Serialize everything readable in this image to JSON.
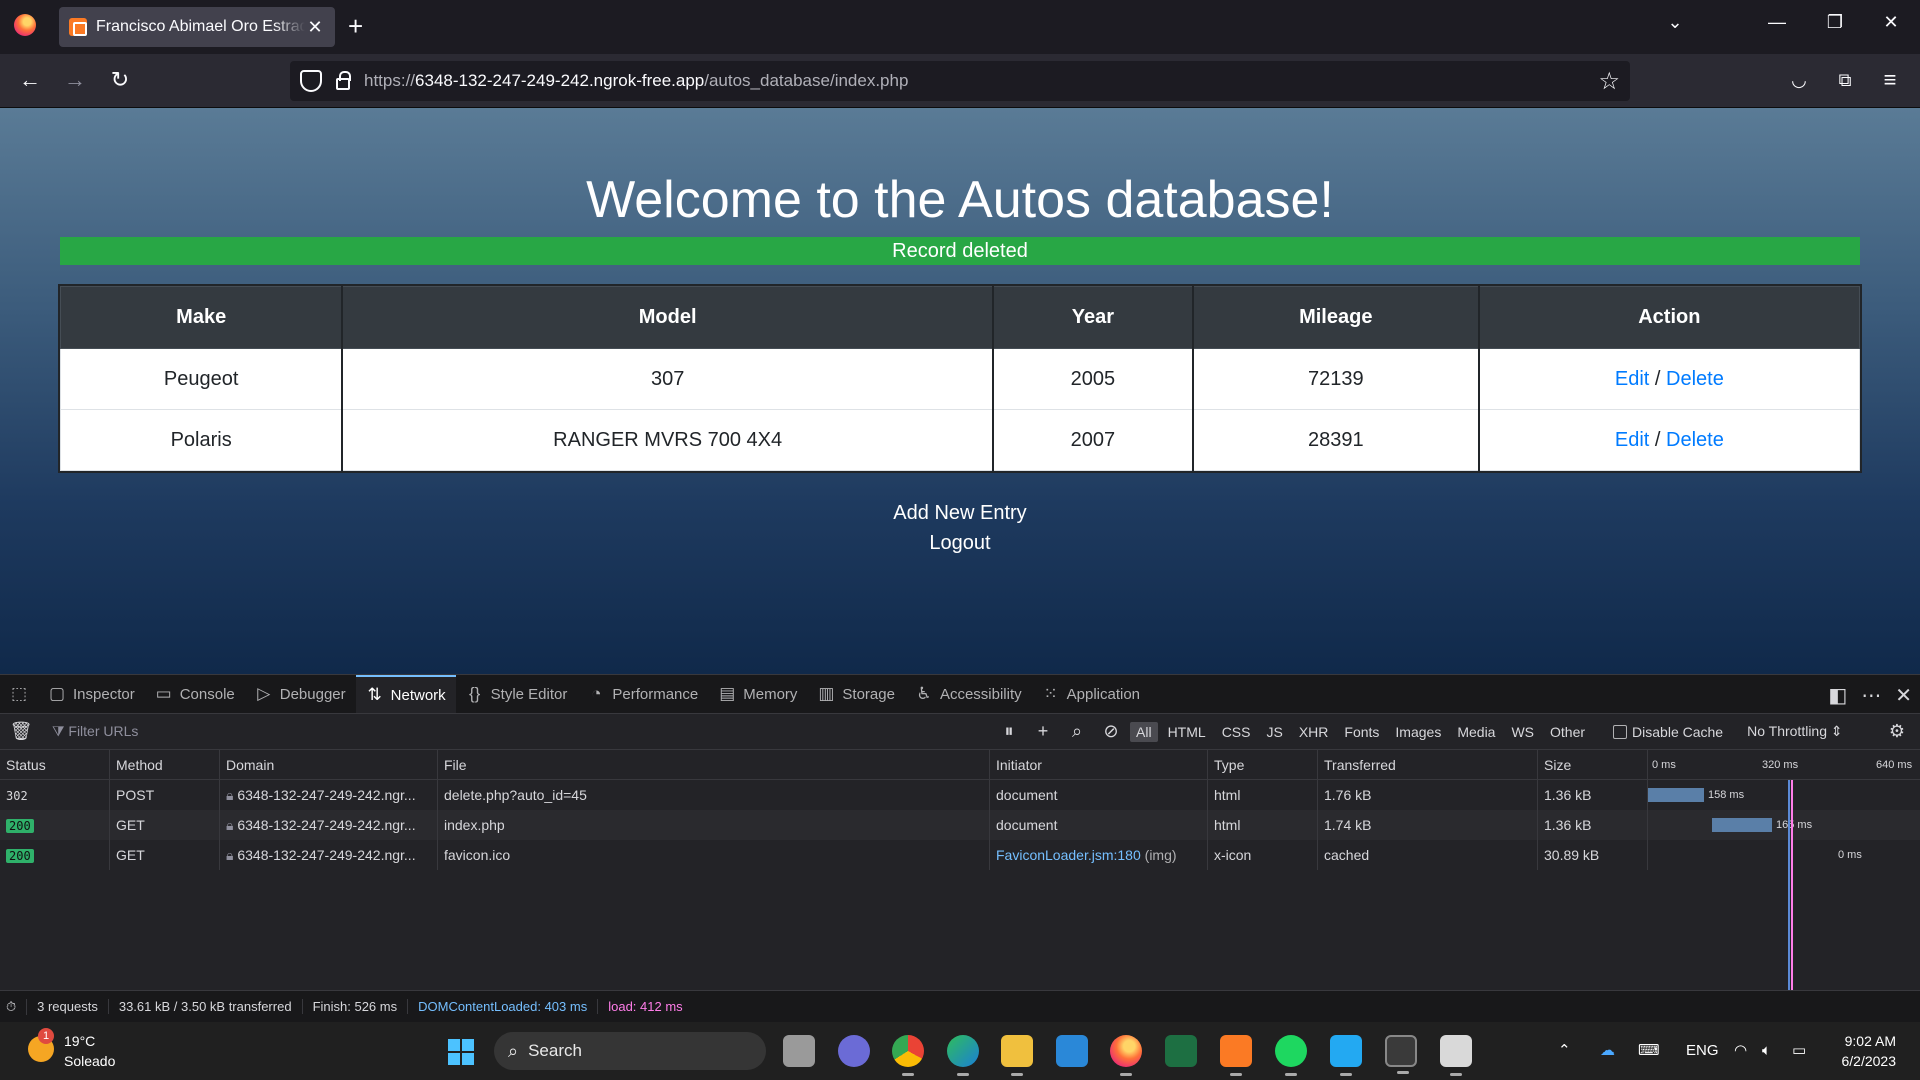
{
  "browser": {
    "tab_title": "Francisco Abimael Oro Estrada",
    "url_prefix": "https://",
    "url_host": "6348-132-247-249-242.ngrok-free.app",
    "url_path": "/autos_database/index.php"
  },
  "page": {
    "title": "Welcome to the Autos database!",
    "flash": "Record deleted",
    "table": {
      "headers": [
        "Make",
        "Model",
        "Year",
        "Mileage",
        "Action"
      ],
      "rows": [
        {
          "make": "Peugeot",
          "model": "307",
          "year": "2005",
          "mileage": "72139",
          "edit": "Edit",
          "sep": " / ",
          "delete": "Delete"
        },
        {
          "make": "Polaris",
          "model": "RANGER MVRS 700 4X4",
          "year": "2007",
          "mileage": "28391",
          "edit": "Edit",
          "sep": " / ",
          "delete": "Delete"
        }
      ]
    },
    "add_new": "Add New Entry",
    "logout": "Logout"
  },
  "devtools": {
    "tabs": [
      "Inspector",
      "Console",
      "Debugger",
      "Network",
      "Style Editor",
      "Performance",
      "Memory",
      "Storage",
      "Accessibility",
      "Application"
    ],
    "active_tab": "Network",
    "filter_placeholder": "Filter URLs",
    "type_filters": [
      "All",
      "HTML",
      "CSS",
      "JS",
      "XHR",
      "Fonts",
      "Images",
      "Media",
      "WS",
      "Other"
    ],
    "disable_cache": "Disable Cache",
    "throttling": "No Throttling",
    "columns": [
      "Status",
      "Method",
      "Domain",
      "File",
      "Initiator",
      "Type",
      "Transferred",
      "Size"
    ],
    "waterfall_ticks": [
      "0 ms",
      "320 ms",
      "640 ms"
    ],
    "requests": [
      {
        "status": "302",
        "method": "POST",
        "domain": "6348-132-247-249-242.ngr...",
        "file": "delete.php?auto_id=45",
        "initiator": "document",
        "initiator_extra": "",
        "type": "html",
        "transferred": "1.76 kB",
        "size": "1.36 kB",
        "timing": "158 ms"
      },
      {
        "status": "200",
        "method": "GET",
        "domain": "6348-132-247-249-242.ngr...",
        "file": "index.php",
        "initiator": "document",
        "initiator_extra": "",
        "type": "html",
        "transferred": "1.74 kB",
        "size": "1.36 kB",
        "timing": "165 ms"
      },
      {
        "status": "200",
        "method": "GET",
        "domain": "6348-132-247-249-242.ngr...",
        "file": "favicon.ico",
        "initiator": "FaviconLoader.jsm:180",
        "initiator_extra": "(img)",
        "type": "x-icon",
        "transferred": "cached",
        "size": "30.89 kB",
        "timing": "0 ms"
      }
    ],
    "status": {
      "requests": "3 requests",
      "transferred": "33.61 kB / 3.50 kB transferred",
      "finish": "Finish: 526 ms",
      "dcl": "DOMContentLoaded: 403 ms",
      "load": "load: 412 ms"
    }
  },
  "taskbar": {
    "weather_temp": "19°C",
    "weather_desc": "Soleado",
    "weather_badge": "1",
    "search_label": "Search",
    "lang": "ENG",
    "time": "9:02 AM",
    "date": "6/2/2023"
  }
}
